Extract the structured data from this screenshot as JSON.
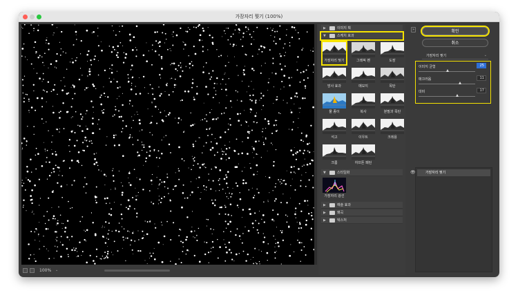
{
  "window": {
    "title": "가장자리 찢기 (100%)"
  },
  "status": {
    "zoom": "100%",
    "zoom_chevron": "⌄"
  },
  "gallery": {
    "folders": {
      "distort": {
        "label": "이미지 획",
        "arrow": "▶"
      },
      "sketch": {
        "label": "스케치 효과",
        "arrow": "▼"
      },
      "stylize": {
        "label": "스타일화",
        "arrow": "▼"
      },
      "texture_ink": {
        "label": "예술 효과",
        "arrow": "▶"
      },
      "brush": {
        "label": "왜곡",
        "arrow": "▶"
      },
      "texture": {
        "label": "텍스처",
        "arrow": "▶"
      }
    },
    "sketch_filters": [
      "가장자리 찢기",
      "그래픽 펜",
      "도장",
      "망사 효과",
      "메모지",
      "목탄",
      "물 종이",
      "복사",
      "분필과 목탄",
      "석고",
      "이우트",
      "크레용",
      "크롬",
      "하프톤 패턴"
    ],
    "stylize_filters": [
      "가장자리 광선"
    ]
  },
  "controls": {
    "collapse_icon": "»",
    "ok_label": "확인",
    "cancel_label": "취소",
    "filter_select": "가장자리 찢기",
    "params": [
      {
        "label": "이미지 균형",
        "value": "25",
        "level": 0.51
      },
      {
        "label": "매끄러움",
        "value": "11",
        "level": 0.73
      },
      {
        "label": "대비",
        "value": "17",
        "level": 0.68
      }
    ]
  },
  "layers": {
    "item_label": "가장자리 찢기"
  },
  "colors": {
    "highlight": "#f6e300",
    "window_bg": "#3a3a3a",
    "preview_bg": "#000000",
    "selected_value_bg": "#2f6fd6"
  }
}
